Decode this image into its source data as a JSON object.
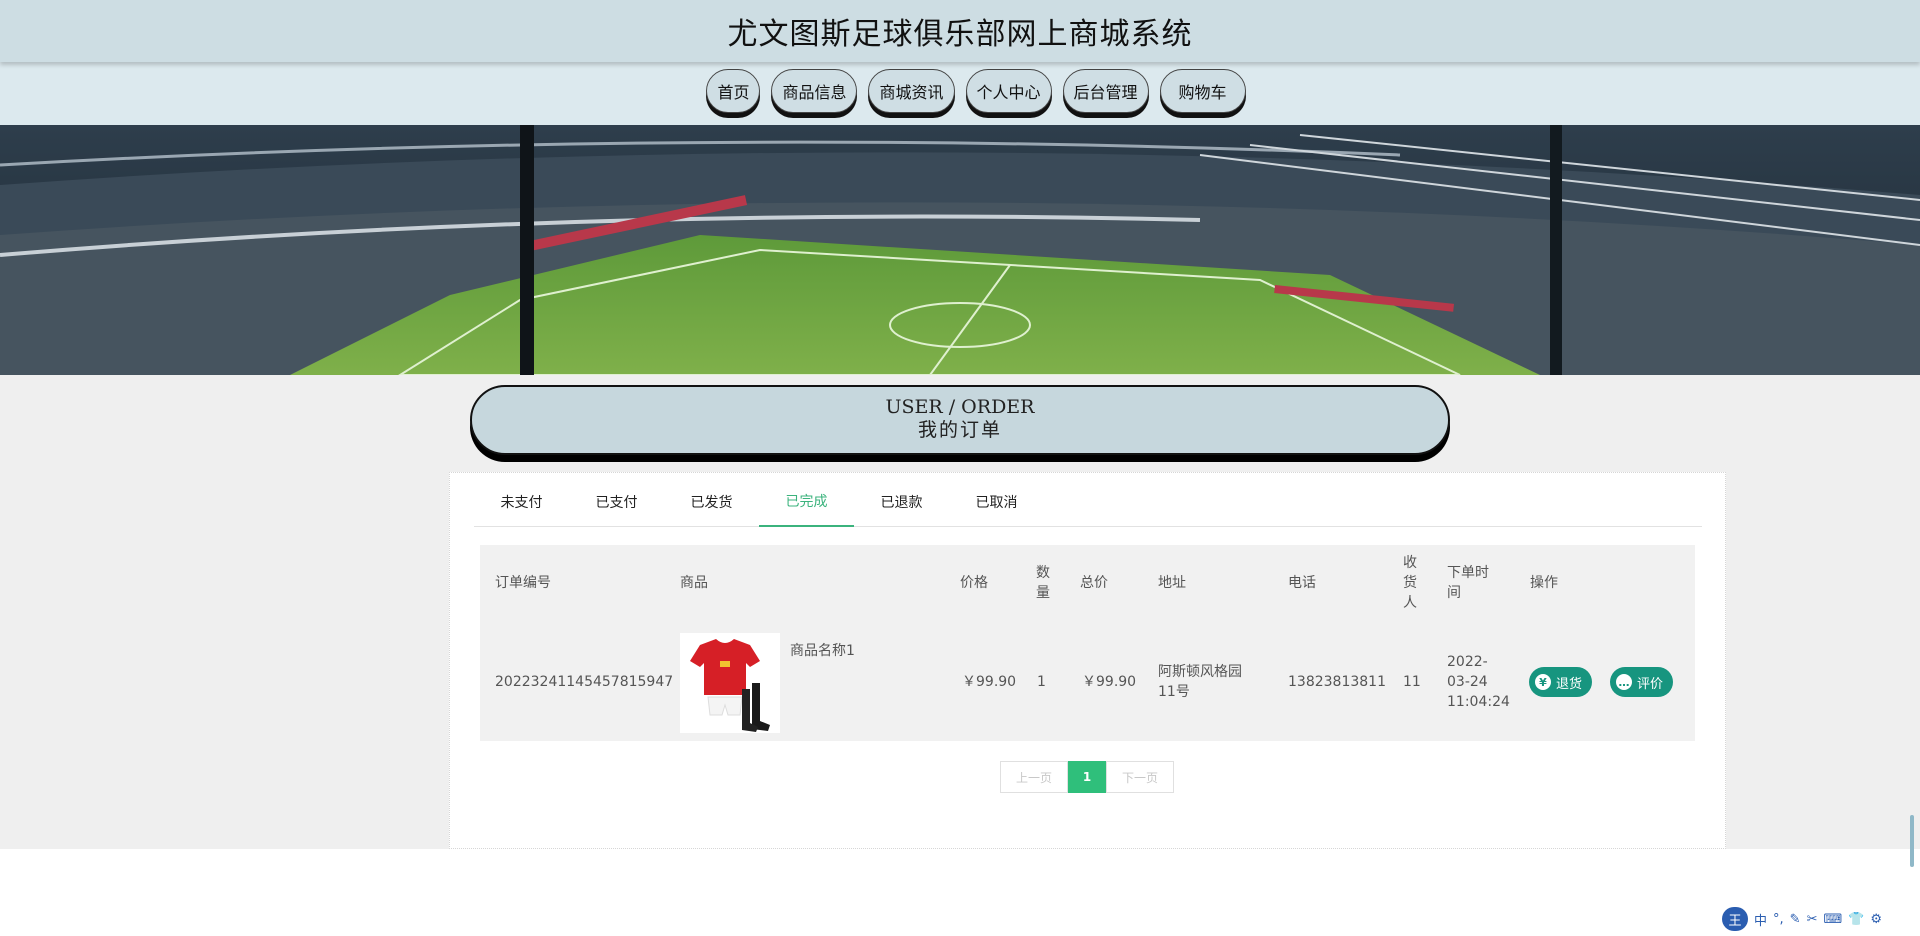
{
  "site": {
    "title": "尤文图斯足球俱乐部网上商城系统"
  },
  "nav": {
    "home": "首页",
    "products": "商品信息",
    "news": "商城资讯",
    "profile": "个人中心",
    "admin": "后台管理",
    "cart": "购物车"
  },
  "section": {
    "title_en": "USER / ORDER",
    "title_zh": "我的订单"
  },
  "tabs": [
    "未支付",
    "已支付",
    "已发货",
    "已完成",
    "已退款",
    "已取消"
  ],
  "active_tab": "已完成",
  "table": {
    "headers": {
      "order_no": "订单编号",
      "product": "商品",
      "price": "价格",
      "qty": "数量",
      "total": "总价",
      "address": "地址",
      "phone": "电话",
      "receiver": "收货人",
      "order_time": "下单时间",
      "actions": "操作"
    },
    "rows": [
      {
        "order_no": "20223241145457815947",
        "product_name": "商品名称1",
        "price": "￥99.90",
        "qty": "1",
        "total": "￥99.90",
        "address": "阿斯顿风格园11号",
        "phone": "13823813811",
        "receiver": "11",
        "order_time": "2022-03-24 11:04:24",
        "refund_label": "退货",
        "review_label": "评价"
      }
    ]
  },
  "pager": {
    "prev": "上一页",
    "current": "1",
    "next": "下一页"
  },
  "ime": {
    "logo": "王",
    "mode": "中"
  },
  "colors": {
    "accent": "#3bb37d",
    "button": "#17957f",
    "header_bg": "#cddde3"
  }
}
